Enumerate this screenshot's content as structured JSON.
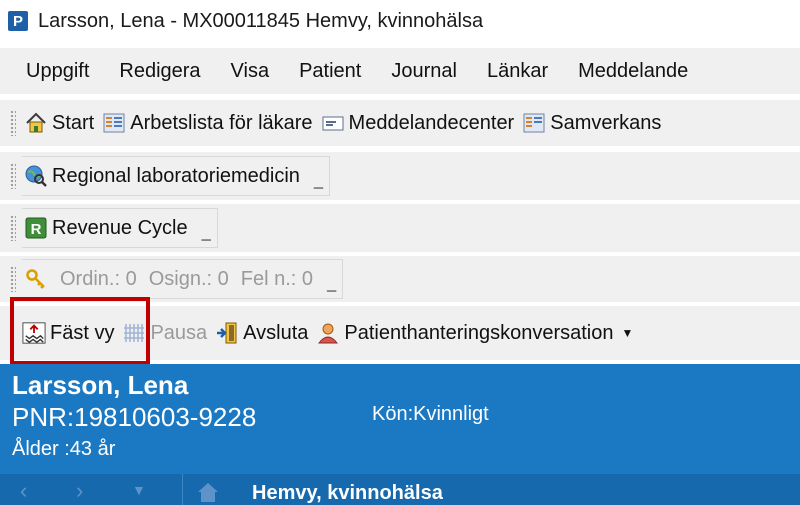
{
  "window": {
    "app_icon_letter": "P",
    "title": "Larsson, Lena - MX00011845 Hemvy, kvinnohälsa"
  },
  "menu": {
    "items": [
      "Uppgift",
      "Redigera",
      "Visa",
      "Patient",
      "Journal",
      "Länkar",
      "Meddelande"
    ]
  },
  "toolbar_nav": {
    "start": "Start",
    "worklist": "Arbetslista för läkare",
    "message_center": "Meddelandecenter",
    "collab": "Samverkans"
  },
  "toolbar_regional": {
    "label": "Regional laboratoriemedicin"
  },
  "toolbar_revenue": {
    "label": "Revenue Cycle",
    "icon_letter": "R"
  },
  "toolbar_orders": {
    "ordin": "Ordin.: 0",
    "osign": "Osign.: 0",
    "fel": "Fel n.: 0"
  },
  "toolbar_actions": {
    "fast_vy": "Fäst vy",
    "pausa": "Pausa",
    "avsluta": "Avsluta",
    "conversation": "Patienthanteringskonversation"
  },
  "patient": {
    "name": "Larsson, Lena",
    "pnr": "PNR:19810603-9228",
    "gender": "Kön:Kvinnligt",
    "age": "Ålder :43 år"
  },
  "nav": {
    "title": "Hemvy, kvinnohälsa"
  },
  "colors": {
    "header_blue": "#1b78c2",
    "highlight_red": "#c00000"
  }
}
